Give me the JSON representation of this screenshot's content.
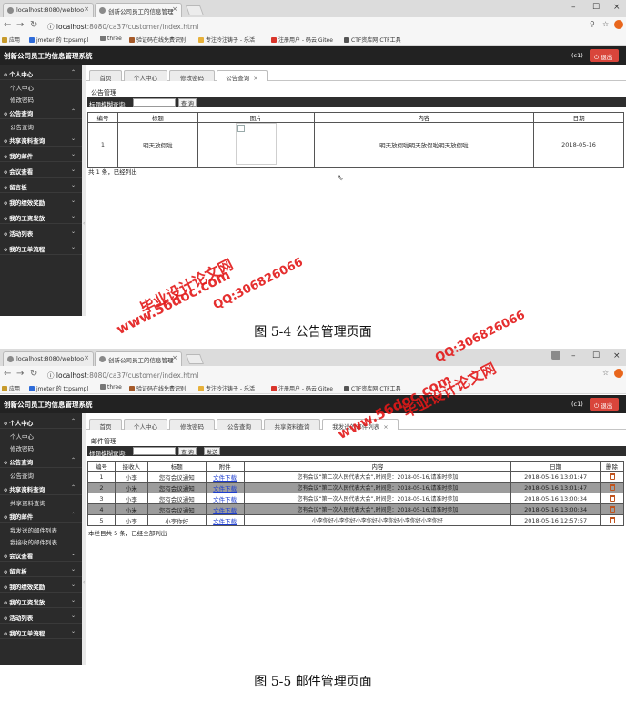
{
  "browser_shot1": {
    "tabs": [
      {
        "title": "localhost:8080/webtoo",
        "close": "×"
      },
      {
        "title": "创新公司员工的信息管理",
        "close": "×"
      }
    ],
    "window_controls": [
      "–",
      "☐",
      "×"
    ],
    "url_host": "localhost",
    "url_path": ":8080/ca37/customer/index.html"
  },
  "browser_shot2": {
    "tabs": [
      {
        "title": "localhost:8080/webtoo",
        "close": "×"
      },
      {
        "title": "创新公司员工的信息管理",
        "close": "×"
      }
    ],
    "window_controls": [
      "–",
      "☐",
      "×"
    ],
    "url_host": "localhost",
    "url_path": ":8080/ca37/customer/index.html"
  },
  "bookmarks": [
    "应用",
    "jmeter 的 tcpsampl",
    "three",
    "验证码在线免费识别",
    "专注冷注铸子 - 乐活",
    "注册用户 - 码云 Gitee",
    "CTF资库网|CTF工具"
  ],
  "app": {
    "title": "创新公司员工的信息管理系统",
    "user": "(c1)",
    "logout": "退出",
    "gutter_arrow": "‹"
  },
  "sidebar1": [
    {
      "type": "group",
      "label": "个人中心",
      "chev": "⌃"
    },
    {
      "type": "sub",
      "label": "个人中心"
    },
    {
      "type": "sub",
      "label": "修改密码"
    },
    {
      "type": "group",
      "label": "公告查询",
      "chev": "⌃"
    },
    {
      "type": "sub",
      "label": "公告查询"
    },
    {
      "type": "group",
      "label": "共享资料查询",
      "chev": "⌄"
    },
    {
      "type": "group",
      "label": "我的邮件",
      "chev": "⌄"
    },
    {
      "type": "group",
      "label": "会议查看",
      "chev": "⌄"
    },
    {
      "type": "group",
      "label": "留言板",
      "chev": "⌄"
    },
    {
      "type": "group",
      "label": "我的绩效奖励",
      "chev": "⌄"
    },
    {
      "type": "group",
      "label": "我的工资发放",
      "chev": "⌄"
    },
    {
      "type": "group",
      "label": "活动列表",
      "chev": "⌄"
    },
    {
      "type": "group",
      "label": "我的工单流程",
      "chev": "⌄"
    }
  ],
  "sidebar2": [
    {
      "type": "group",
      "label": "个人中心",
      "chev": "⌃"
    },
    {
      "type": "sub",
      "label": "个人中心"
    },
    {
      "type": "sub",
      "label": "修改密码"
    },
    {
      "type": "group",
      "label": "公告查询",
      "chev": "⌃"
    },
    {
      "type": "sub",
      "label": "公告查询"
    },
    {
      "type": "group",
      "label": "共享资料查询",
      "chev": "⌃"
    },
    {
      "type": "sub",
      "label": "共享资料查询"
    },
    {
      "type": "group",
      "label": "我的邮件",
      "chev": "⌃"
    },
    {
      "type": "sub",
      "label": "我发送的邮件列表"
    },
    {
      "type": "sub",
      "label": "我接收的邮件列表"
    },
    {
      "type": "group",
      "label": "会议查看",
      "chev": "⌄"
    },
    {
      "type": "group",
      "label": "留言板",
      "chev": "⌄"
    },
    {
      "type": "group",
      "label": "我的绩效奖励",
      "chev": "⌄"
    },
    {
      "type": "group",
      "label": "我的工资发放",
      "chev": "⌄"
    },
    {
      "type": "group",
      "label": "活动列表",
      "chev": "⌄"
    },
    {
      "type": "group",
      "label": "我的工单流程",
      "chev": "⌄"
    }
  ],
  "shot1": {
    "tabs": [
      "首页",
      "个人中心",
      "修改密码",
      "公告查询"
    ],
    "tab_close": "×",
    "section_title": "公告管理",
    "search_label": "标题模糊查询:",
    "search_button": "查 询",
    "columns": [
      "编号",
      "标题",
      "图片",
      "内容",
      "日期"
    ],
    "rows": [
      {
        "id": "1",
        "title": "明天放假啦",
        "content": "明天放假啦明天放假啦明天放假啦",
        "date": "2018-05-16"
      }
    ],
    "total": "共 1 条，已经列出",
    "caption": "图 5-4 公告管理页面"
  },
  "shot2": {
    "tabs": [
      "首页",
      "个人中心",
      "修改密码",
      "公告查询",
      "共享资料查询",
      "我发送的邮件列表"
    ],
    "tab_close": "×",
    "section_title": "邮件管理",
    "search_label": "标题模糊查询:",
    "search_button": "查 询",
    "send_button": "发送",
    "columns": [
      "编号",
      "接收人",
      "标题",
      "附件",
      "内容",
      "日期",
      "删除"
    ],
    "rows": [
      {
        "id": "1",
        "receiver": "小李",
        "title": "您有会议通知",
        "attachment": "文件下载",
        "content": "您有会议“第二次人民代表大会”,时间是：2018-05-16,请准时参加",
        "date": "2018-05-16 13:01:47"
      },
      {
        "id": "2",
        "receiver": "小米",
        "title": "您有会议通知",
        "attachment": "文件下载",
        "content": "您有会议“第二次人民代表大会”,时间是：2018-05-16,请准时参加",
        "date": "2018-05-16 13:01:47"
      },
      {
        "id": "3",
        "receiver": "小李",
        "title": "您有会议通知",
        "attachment": "文件下载",
        "content": "您有会议“第一次人民代表大会”,时间是：2018-05-16,请准时参加",
        "date": "2018-05-16 13:00:34"
      },
      {
        "id": "4",
        "receiver": "小米",
        "title": "您有会议通知",
        "attachment": "文件下载",
        "content": "您有会议“第一次人民代表大会”,时间是：2018-05-16,请准时参加",
        "date": "2018-05-16 13:00:34"
      },
      {
        "id": "5",
        "receiver": "小李",
        "title": "小李你好",
        "attachment": "文件下载",
        "content": "小李你好小李你好小李你好小李你好小李你好小李你好",
        "date": "2018-05-16 12:57:57"
      }
    ],
    "total": "本栏目共 5 条，已经全部列出",
    "caption": "图 5-5 邮件管理页面"
  },
  "watermarks": {
    "site": "www.56doc.com",
    "name": "毕业设计论文网",
    "qq": "QQ:306826066"
  }
}
